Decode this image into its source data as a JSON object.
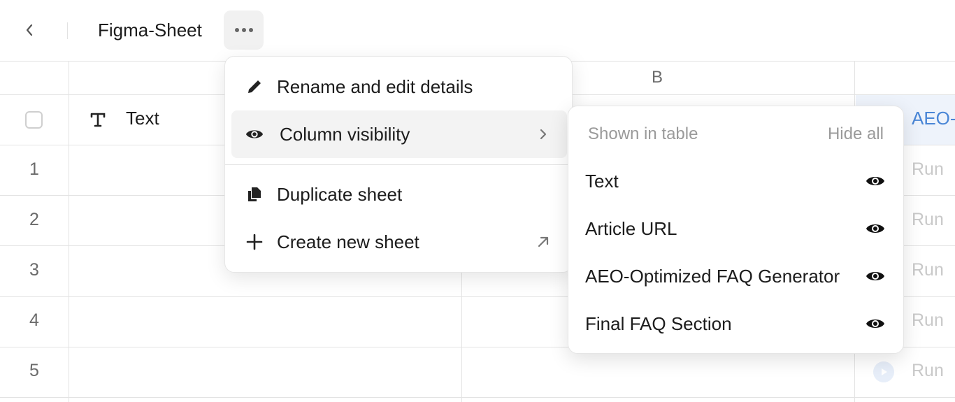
{
  "topbar": {
    "title": "Figma-Sheet",
    "back_icon": "chevron-left-icon",
    "more_icon": "more-horizontal-icon"
  },
  "grid": {
    "columns": [
      "B"
    ],
    "headers": {
      "text": "Text",
      "aeo": "AEO-"
    },
    "rows": [
      {
        "num": "1",
        "run": "Run"
      },
      {
        "num": "2",
        "run": "Run"
      },
      {
        "num": "3",
        "run": "Run"
      },
      {
        "num": "4",
        "run": "Run"
      },
      {
        "num": "5",
        "run": "Run"
      }
    ]
  },
  "menu": {
    "items": [
      {
        "label": "Rename and edit details",
        "icon": "pencil-icon"
      },
      {
        "label": "Column visibility",
        "icon": "eye-icon",
        "trail": "chevron-right-icon"
      },
      {
        "label": "Duplicate sheet",
        "icon": "copy-icon"
      },
      {
        "label": "Create new sheet",
        "icon": "plus-icon",
        "trail": "arrow-up-right-icon"
      }
    ]
  },
  "submenu": {
    "header": "Shown in table",
    "hide_all": "Hide all",
    "items": [
      {
        "label": "Text"
      },
      {
        "label": "Article URL"
      },
      {
        "label": "AEO-Optimized FAQ Generator"
      },
      {
        "label": "Final FAQ Section"
      }
    ]
  },
  "colors": {
    "accent_blue": "#4a86d6",
    "aeo_header_bg": "#eef3fb",
    "active_item_bg": "#f3f3f3"
  }
}
